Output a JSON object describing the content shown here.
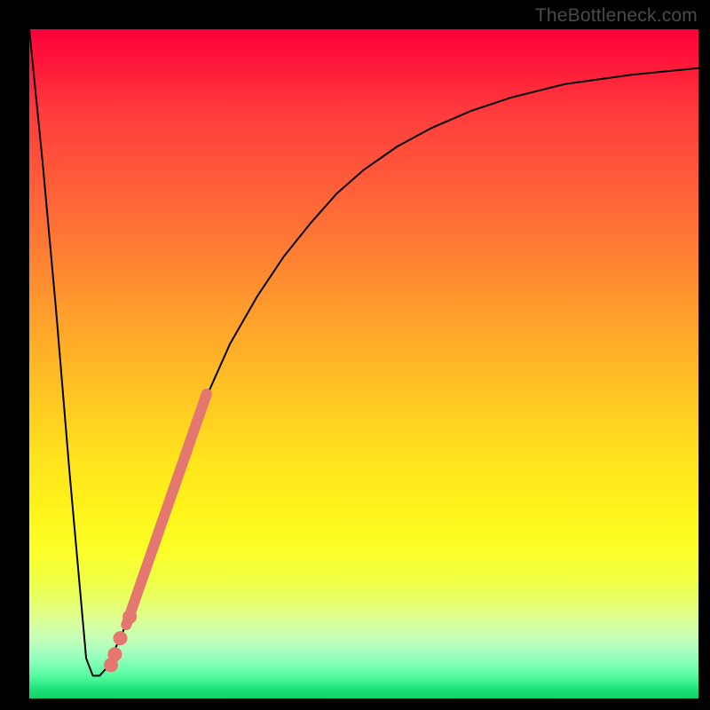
{
  "watermark": "TheBottleneck.com",
  "chart_data": {
    "type": "line",
    "title": "",
    "xlabel": "",
    "ylabel": "",
    "xlim": [
      0,
      100
    ],
    "ylim": [
      0,
      100
    ],
    "grid": false,
    "legend": false,
    "background_gradient": {
      "top": "#ff003a",
      "middle": "#ffe31e",
      "bottom": "#0fd268"
    },
    "series": [
      {
        "name": "bottleneck-curve",
        "color": "#000000",
        "stroke_width": 2,
        "x": [
          0,
          2,
          4,
          6,
          8.5,
          9.5,
          10.5,
          11.5,
          14,
          18,
          22,
          26,
          30,
          34,
          38,
          42,
          46,
          50,
          55,
          60,
          66,
          72,
          80,
          90,
          100
        ],
        "y": [
          100,
          80,
          58,
          34,
          6,
          3.4,
          3.4,
          4.5,
          10,
          22,
          34,
          44,
          53,
          60,
          66,
          71,
          75.5,
          79,
          82.5,
          85.2,
          87.8,
          89.8,
          91.8,
          93.2,
          94.2
        ]
      }
    ],
    "highlight_segment": {
      "color": "#e4776f",
      "thick_width": 12,
      "x": [
        14.5,
        26.5
      ],
      "y": [
        11,
        45.5
      ]
    },
    "highlight_dots": {
      "color": "#e4776f",
      "radius": 8,
      "points": [
        {
          "x": 13.6,
          "y": 9.0
        },
        {
          "x": 12.8,
          "y": 6.6
        },
        {
          "x": 12.2,
          "y": 5.0
        },
        {
          "x": 15.0,
          "y": 12.2
        }
      ]
    }
  }
}
